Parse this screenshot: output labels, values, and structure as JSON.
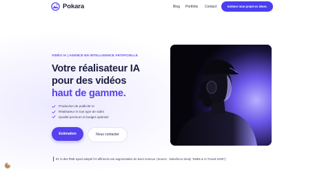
{
  "header": {
    "brand": "Pokara",
    "nav": [
      "Blog",
      "Portfolio",
      "Contact"
    ],
    "cta_label": "Estimer mon projet en 30sec"
  },
  "hero": {
    "eyebrow": "VIDÉO IA | AGENCE EN INTELLIGENCE ARTIFICIELLE",
    "headline_line1": "Votre réalisateur IA",
    "headline_line2": "pour des vidéos",
    "headline_accent": "haut de gamme.",
    "features": [
      "Production de publicité IA",
      "Réalisateur IA tout type de vidéo",
      "Qualité premium et budget optimisé"
    ],
    "primary_button": "Estimation",
    "secondary_button": "Nous contacter"
  },
  "stat": {
    "text": "91 % des PME ayant adopté l'IA affirment une augmentation de leurs revenus. (Source : Salesforce Study \"SMBs & AI Trends 2025\")."
  },
  "colors": {
    "accent": "#5541ee",
    "dark": "#1a1d3d"
  },
  "icons": {
    "logo": "pokara-logo-icon",
    "check": "check-icon",
    "cookie": "cookie-icon"
  }
}
